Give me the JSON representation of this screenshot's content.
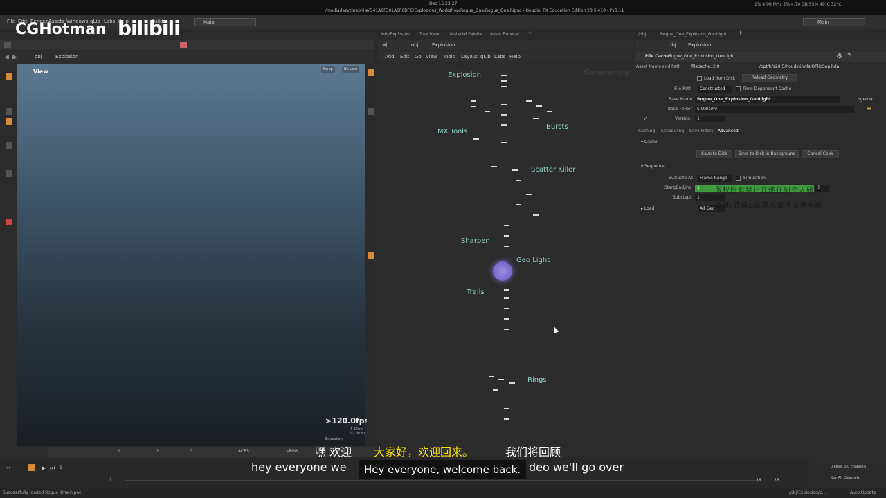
{
  "system": {
    "clock": "Dec 15 23:27",
    "window_title": "/media/lazycinephile/D41A0F301A0F0DFC/Explosions_Workshop/Rogue_One/Rogue_One.hipnc - Houdini FX Education Edition 20.5.410 - Py3.11",
    "tray": "1% 4.96 MHz    2% 4.70 GB 55%   49°C 32°C"
  },
  "watermark": {
    "brand": "CGHotman",
    "site": "bilibili"
  },
  "menubar": {
    "items": [
      "File",
      "Edit",
      "Render",
      "Assets",
      "Windows",
      "qLib",
      "Labs",
      "Help",
      "Build"
    ],
    "desktop_left": "Main",
    "desktop_right": "Main"
  },
  "viewport": {
    "path_network": "obj",
    "path_node": "Explosion",
    "view_label": "View",
    "camera_chip1": "Persp",
    "camera_chip2": "No cam",
    "fps": ">120.0fps",
    "stats": "1.46ms\n97 prims",
    "edu_label": "Education",
    "bottom_color_space": "ACES",
    "bottom_srgb": "sRGB",
    "bottom_frame1": "1",
    "bottom_frame2": "1",
    "bottom_frame3": "0"
  },
  "network": {
    "tabs": [
      "/obj/Explosion",
      "Tree View",
      "Material Palette",
      "Asset Browser"
    ],
    "path_network": "obj",
    "path_node": "Explosion",
    "menu": [
      "Add",
      "Edit",
      "Go",
      "View",
      "Tools",
      "Layout",
      "qLib",
      "Labs",
      "Help"
    ],
    "context_label": "Geometry",
    "labels": {
      "explosion": "Explosion",
      "mx_tools": "MX Tools",
      "bursts": "Bursts",
      "scatter_killer": "Scatter Killer",
      "sharpen": "Sharpen",
      "geo_light": "Geo Light",
      "trails": "Trails",
      "rings": "Rings"
    }
  },
  "parameters": {
    "tabs": [
      "/obj",
      "Rogue_One_Explosion_GeoLight"
    ],
    "path_network": "obj",
    "path_node": "Explosion",
    "node_type": "File Cache",
    "node_name": "Rogue_One_Explosion_GeoLight",
    "asset_label": "Asset Name and Path",
    "asset_value": "filecache::2.0",
    "asset_path": "/opt/hfs20.5/houdini/otls/OPlibSop.hda",
    "load_from_disk": "Load from Disk",
    "reload_geometry": "Reload Geometry",
    "file_path_label": "File Path",
    "file_path_value": "Constructed",
    "time_dependent": "Time Dependent Cache",
    "base_name_label": "Base Name",
    "base_name_value": "Rogue_One_Explosion_GeoLight",
    "base_name_ext": "bgeo.sc",
    "base_folder_label": "Base Folder",
    "base_folder_value": "$JOB/sim/",
    "version_label": "Version",
    "version_value": "1",
    "subtabs": [
      "Caching",
      "Scheduling",
      "Save Filters",
      "Advanced"
    ],
    "cache_section": "Cache",
    "save_to_disk": "Save to Disk",
    "save_bg": "Save to Disk in Background",
    "cancel_cook": "Cancel Cook",
    "sequence_section": "Sequence",
    "evaluate_as_label": "Evaluate As",
    "evaluate_as_value": "Frame Range",
    "simulation": "Simulation",
    "startend_label": "Start/End/Inc",
    "start_value": "1",
    "inc_value": "1",
    "substeps_label": "Substeps",
    "substeps_value": "1",
    "load_section": "Load",
    "all_geo": "All Geo",
    "overlay_line1": "版权所有禁止在他任何个人研究",
    "overlay_line2": "盗录/转载B站等人录担法律全部"
  },
  "timeline": {
    "start": "1",
    "start2": "1",
    "end": "36",
    "end2": "36",
    "keys": "0 keys, 0/0 channels",
    "key_all": "Key All Channels",
    "auto_update": "Auto Update",
    "obj_path": "/obj/Explosion/p..."
  },
  "status": {
    "message": "Successfully loaded Rogue_One.hipnc"
  },
  "subtitles": {
    "cn_prefix": "嘿 欢迎",
    "cn_highlight": "大家好，欢迎回来。",
    "cn_suffix": "我们将回顾",
    "en_line": "hey everyone we",
    "en_suffix": "deo we'll go over",
    "box": "Hey everyone, welcome back."
  }
}
